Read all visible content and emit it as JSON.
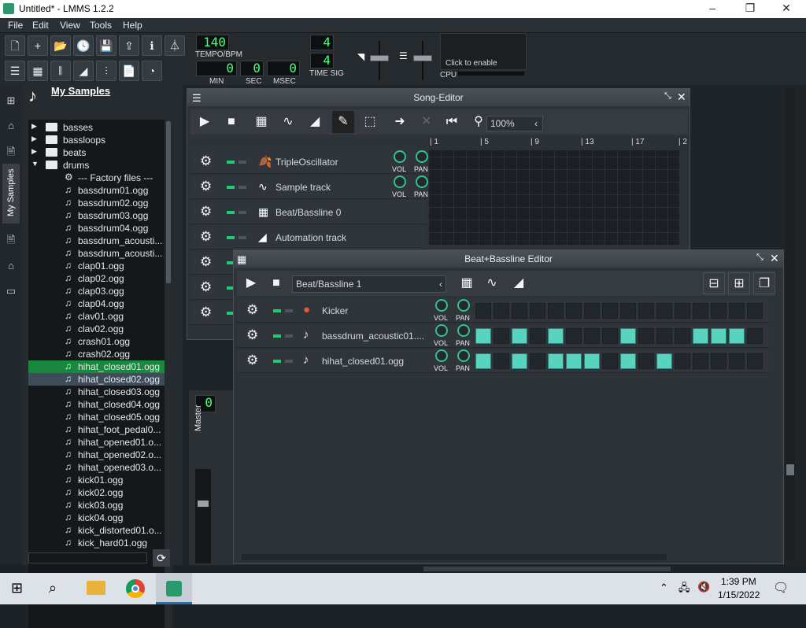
{
  "window": {
    "title": "Untitled* - LMMS 1.2.2",
    "min": "–",
    "max": "❐",
    "close": "✕"
  },
  "menu": [
    "File",
    "Edit",
    "View",
    "Tools",
    "Help"
  ],
  "toolbar": {
    "tempo": "140",
    "tempo_label": "TEMPO/BPM",
    "min": "0",
    "sec": "0",
    "msec": "0",
    "min_label": "MIN",
    "sec_label": "SEC",
    "msec_label": "MSEC",
    "ts_num": "4",
    "ts_den": "4",
    "ts_label": "TIME SIG",
    "cpu_hint": "Click to enable",
    "cpu_label": "CPU"
  },
  "browser": {
    "title": "My Samples",
    "side_label": "My Samples",
    "items": [
      {
        "type": "folder",
        "label": "basses",
        "indent": 0
      },
      {
        "type": "folder",
        "label": "bassloops",
        "indent": 0
      },
      {
        "type": "folder",
        "label": "beats",
        "indent": 0
      },
      {
        "type": "folder-open",
        "label": "drums",
        "indent": 0
      },
      {
        "type": "special",
        "label": "--- Factory files ---",
        "indent": 1
      },
      {
        "type": "file",
        "label": "bassdrum01.ogg",
        "indent": 1
      },
      {
        "type": "file",
        "label": "bassdrum02.ogg",
        "indent": 1
      },
      {
        "type": "file",
        "label": "bassdrum03.ogg",
        "indent": 1
      },
      {
        "type": "file",
        "label": "bassdrum04.ogg",
        "indent": 1
      },
      {
        "type": "file",
        "label": "bassdrum_acousti...",
        "indent": 1
      },
      {
        "type": "file",
        "label": "bassdrum_acousti...",
        "indent": 1
      },
      {
        "type": "file",
        "label": "clap01.ogg",
        "indent": 1
      },
      {
        "type": "file",
        "label": "clap02.ogg",
        "indent": 1
      },
      {
        "type": "file",
        "label": "clap03.ogg",
        "indent": 1
      },
      {
        "type": "file",
        "label": "clap04.ogg",
        "indent": 1
      },
      {
        "type": "file",
        "label": "clav01.ogg",
        "indent": 1
      },
      {
        "type": "file",
        "label": "clav02.ogg",
        "indent": 1
      },
      {
        "type": "file",
        "label": "crash01.ogg",
        "indent": 1
      },
      {
        "type": "file",
        "label": "crash02.ogg",
        "indent": 1
      },
      {
        "type": "file",
        "label": "hihat_closed01.ogg",
        "indent": 1,
        "sel": 1
      },
      {
        "type": "file",
        "label": "hihat_closed02.ogg",
        "indent": 1,
        "sel": 2
      },
      {
        "type": "file",
        "label": "hihat_closed03.ogg",
        "indent": 1
      },
      {
        "type": "file",
        "label": "hihat_closed04.ogg",
        "indent": 1
      },
      {
        "type": "file",
        "label": "hihat_closed05.ogg",
        "indent": 1
      },
      {
        "type": "file",
        "label": "hihat_foot_pedal0...",
        "indent": 1
      },
      {
        "type": "file",
        "label": "hihat_opened01.o...",
        "indent": 1
      },
      {
        "type": "file",
        "label": "hihat_opened02.o...",
        "indent": 1
      },
      {
        "type": "file",
        "label": "hihat_opened03.o...",
        "indent": 1
      },
      {
        "type": "file",
        "label": "kick01.ogg",
        "indent": 1
      },
      {
        "type": "file",
        "label": "kick02.ogg",
        "indent": 1
      },
      {
        "type": "file",
        "label": "kick03.ogg",
        "indent": 1
      },
      {
        "type": "file",
        "label": "kick04.ogg",
        "indent": 1
      },
      {
        "type": "file",
        "label": "kick_distorted01.o...",
        "indent": 1
      },
      {
        "type": "file",
        "label": "kick_hard01.ogg",
        "indent": 1
      }
    ]
  },
  "song_editor": {
    "title": "Song-Editor",
    "zoom": "100%",
    "ruler": [
      "1",
      "5",
      "9",
      "13",
      "17",
      "2"
    ],
    "tracks": [
      {
        "name": "TripleOscillator",
        "icon": "triple-osc",
        "knobs": true
      },
      {
        "name": "Sample track",
        "icon": "waveform",
        "knobs": true
      },
      {
        "name": "Beat/Bassline 0",
        "icon": "grid",
        "knobs": false
      },
      {
        "name": "Automation track",
        "icon": "ramp",
        "knobs": false
      }
    ],
    "knob_vol": "VOL",
    "knob_pan": "PAN"
  },
  "bb_editor": {
    "title": "Beat+Bassline Editor",
    "selected": "Beat/Bassline 1",
    "tracks": [
      {
        "name": "Kicker",
        "steps": [
          0,
          0,
          0,
          0,
          0,
          0,
          0,
          0,
          0,
          0,
          0,
          0,
          0,
          0,
          0,
          0
        ]
      },
      {
        "name": "bassdrum_acoustic01....",
        "steps": [
          1,
          0,
          1,
          0,
          1,
          0,
          0,
          0,
          1,
          0,
          0,
          0,
          1,
          1,
          1,
          0
        ]
      },
      {
        "name": "hihat_closed01.ogg",
        "steps": [
          1,
          0,
          1,
          0,
          1,
          1,
          1,
          0,
          1,
          0,
          1,
          0,
          0,
          0,
          0,
          0
        ]
      }
    ],
    "knob_vol": "VOL",
    "knob_pan": "PAN"
  },
  "mixer": {
    "lcd": "0",
    "label": "Master"
  },
  "taskbar": {
    "time": "1:39 PM",
    "date": "1/15/2022"
  },
  "colors": {
    "accent": "#31c28c",
    "step_on": "#59d2c0",
    "lcd": "#4bff7a",
    "selection": "#19883f"
  }
}
